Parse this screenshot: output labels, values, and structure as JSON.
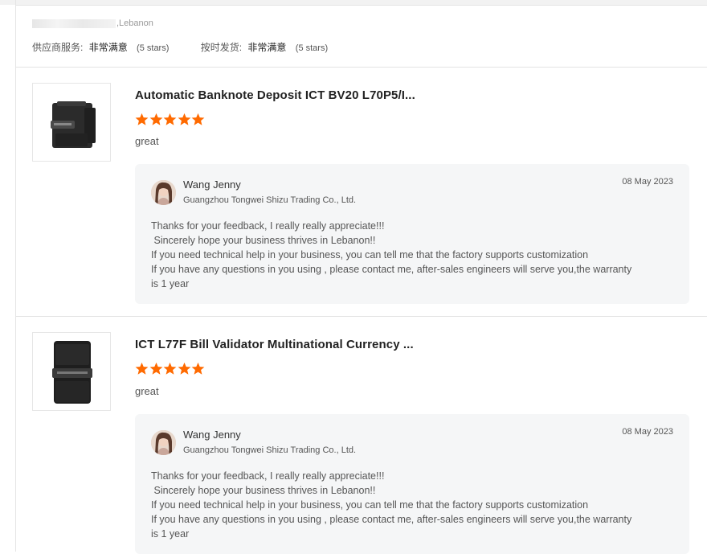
{
  "buyer": {
    "location": ",Lebanon"
  },
  "ratings": [
    {
      "label": "供应商服务:",
      "value": "非常满意",
      "stars_text": "(5 stars)"
    },
    {
      "label": "按时发货:",
      "value": "非常满意",
      "stars_text": "(5 stars)"
    }
  ],
  "reviews": [
    {
      "product_title": "Automatic Banknote Deposit ICT BV20 L70P5/I...",
      "rating": 5,
      "comment": "great",
      "reply": {
        "name": "Wang Jenny",
        "company": "Guangzhou Tongwei Shizu Trading Co., Ltd.",
        "date": "08 May 2023",
        "lines": [
          "Thanks for your feedback, I really really appreciate!!!",
          " Sincerely hope your business thrives in Lebanon!!",
          "If you need technical help in your business, you can tell me that the factory supports customization",
          "If you have any questions in you using , please contact me, after-sales engineers will serve you,the warranty",
          "is 1 year"
        ]
      }
    },
    {
      "product_title": "ICT L77F Bill Validator Multinational Currency ...",
      "rating": 5,
      "comment": "great",
      "reply": {
        "name": "Wang Jenny",
        "company": "Guangzhou Tongwei Shizu Trading Co., Ltd.",
        "date": "08 May 2023",
        "lines": [
          "Thanks for your feedback, I really really appreciate!!!",
          " Sincerely hope your business thrives in Lebanon!!",
          "If you need technical help in your business, you can tell me that the factory supports customization",
          "If you have any questions in you using , please contact me, after-sales engineers will serve you,the warranty",
          "is 1 year"
        ]
      }
    }
  ],
  "colors": {
    "star": "#ff6a00",
    "reply_bg": "#f5f6f7",
    "divider": "#e4e4e4"
  },
  "icons": {
    "star": "star-icon"
  }
}
